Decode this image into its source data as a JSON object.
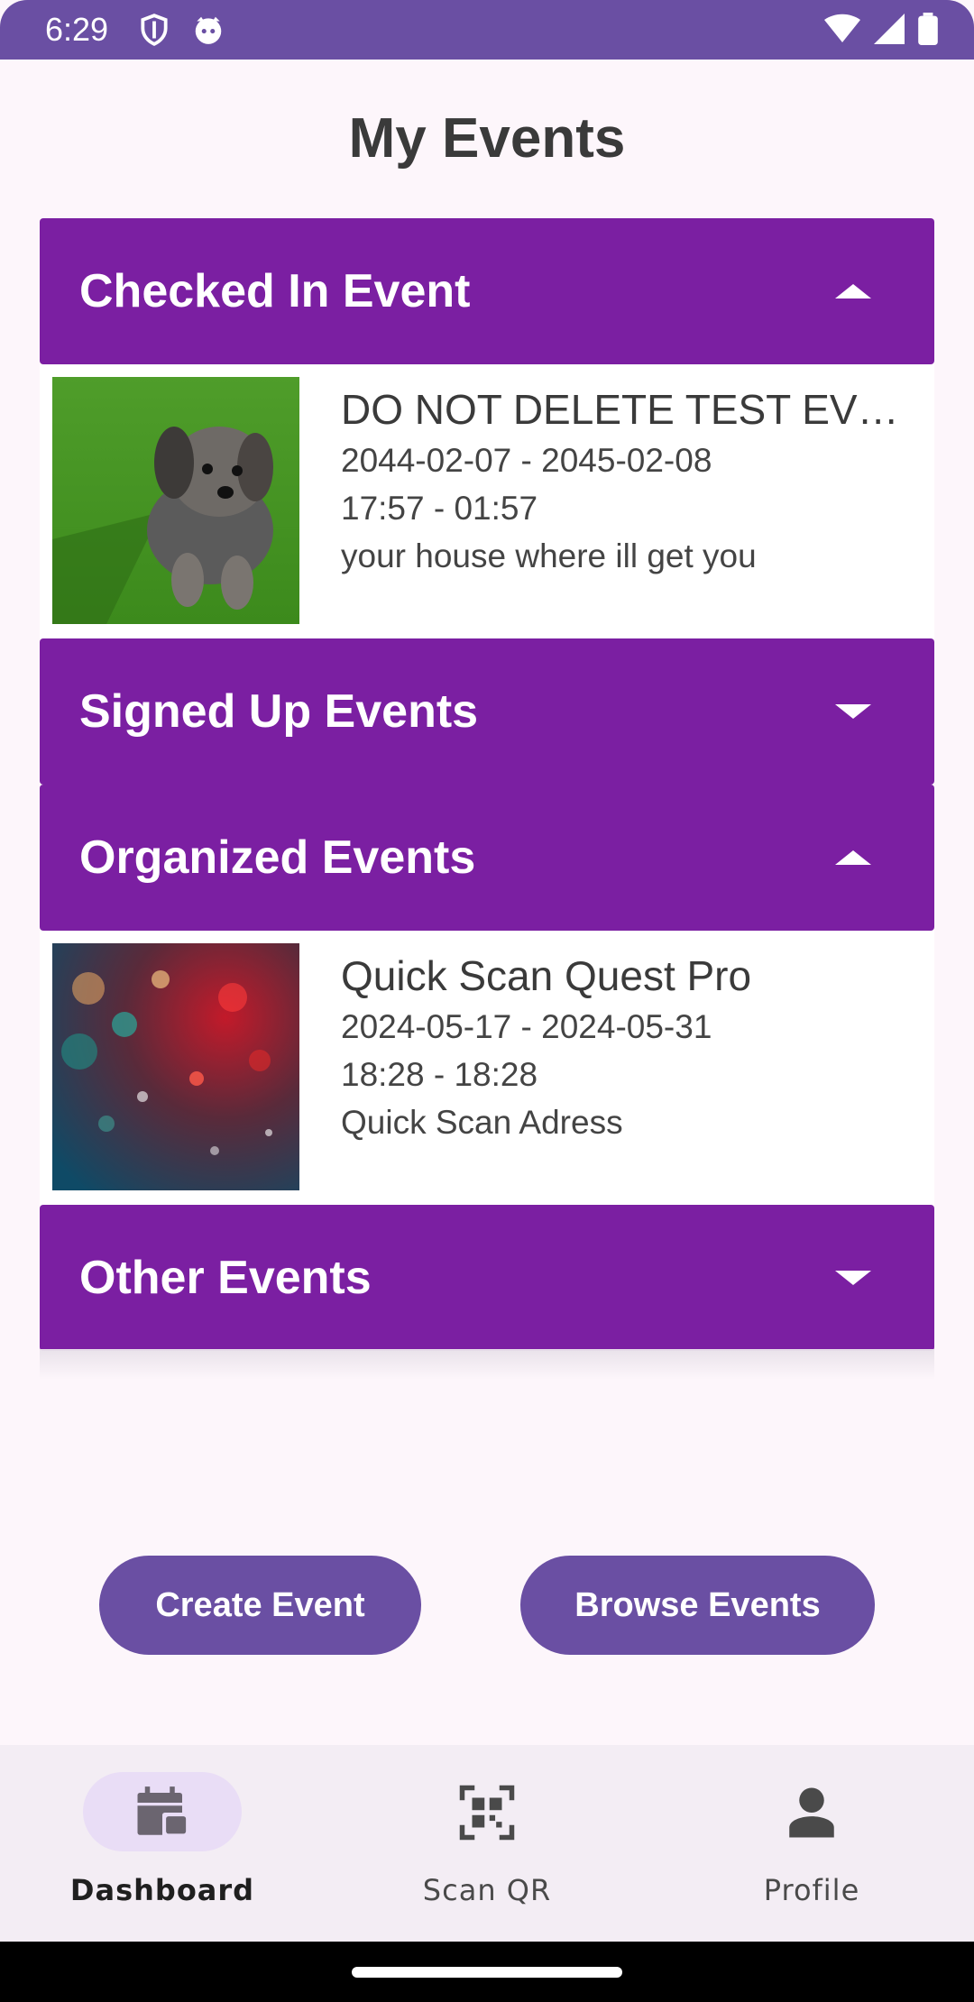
{
  "status_bar": {
    "time": "6:29"
  },
  "title": "My Events",
  "sections": [
    {
      "label": "Checked In Event",
      "expanded": true,
      "event": {
        "name": "DO NOT DELETE TEST EVE...",
        "dates": "2044-02-07 - 2045-02-08",
        "times": "17:57 - 01:57",
        "location": "your house where ill get you",
        "image": "dog-on-grass-photo"
      }
    },
    {
      "label": "Signed Up Events",
      "expanded": false
    },
    {
      "label": "Organized Events",
      "expanded": true,
      "event": {
        "name": "Quick Scan Quest Pro",
        "dates": "2024-05-17 - 2024-05-31",
        "times": "18:28 - 18:28",
        "location": "Quick Scan Adress",
        "image": "bokeh-lights-photo"
      }
    },
    {
      "label": "Other Events",
      "expanded": false
    }
  ],
  "buttons": {
    "create": "Create Event",
    "browse": "Browse Events"
  },
  "bottom_nav": [
    {
      "label": "Dashboard",
      "icon": "calendar-icon",
      "active": true
    },
    {
      "label": "Scan QR",
      "icon": "qr-scan-icon",
      "active": false
    },
    {
      "label": "Profile",
      "icon": "person-icon",
      "active": false
    }
  ],
  "colors": {
    "accent": "#7b1fa2",
    "button": "#6a4fa3",
    "background": "#fdf6fb"
  }
}
